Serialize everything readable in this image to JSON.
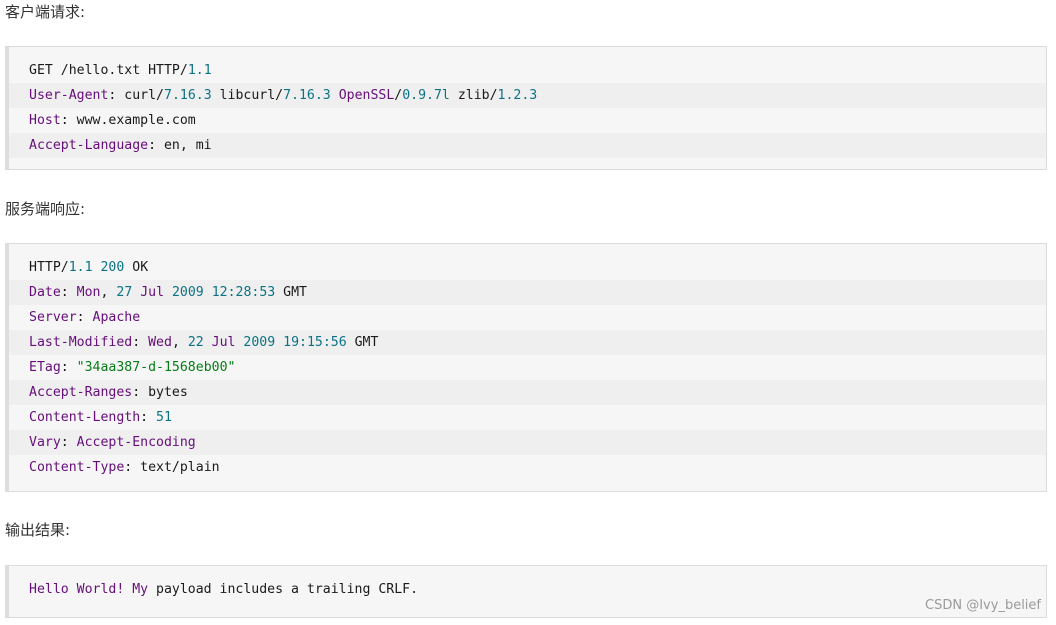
{
  "sections": [
    {
      "label": "客户端请求:",
      "lines": [
        [
          [
            "GET ",
            "plain"
          ],
          [
            "/hello.txt HTTP/",
            "plain"
          ],
          [
            "1.1",
            "num"
          ]
        ],
        [
          [
            "User-Agent",
            "key"
          ],
          [
            ": ",
            "punc"
          ],
          [
            "curl/",
            "plain"
          ],
          [
            "7.16.3",
            "num"
          ],
          [
            " libcurl/",
            "plain"
          ],
          [
            "7.16.3",
            "num"
          ],
          [
            " OpenSSL",
            "key"
          ],
          [
            "/",
            "plain"
          ],
          [
            "0.9.7l",
            "num"
          ],
          [
            " zlib/",
            "plain"
          ],
          [
            "1.2.3",
            "num"
          ]
        ],
        [
          [
            "Host",
            "key"
          ],
          [
            ": ",
            "punc"
          ],
          [
            "www.example.com",
            "plain"
          ]
        ],
        [
          [
            "Accept-Language",
            "key"
          ],
          [
            ": ",
            "punc"
          ],
          [
            "en, mi",
            "plain"
          ]
        ]
      ]
    },
    {
      "label": "服务端响应:",
      "lines": [
        [
          [
            "HTTP/",
            "plain"
          ],
          [
            "1.1",
            "num"
          ],
          [
            " ",
            "plain"
          ],
          [
            "200",
            "num"
          ],
          [
            " OK",
            "plain"
          ]
        ],
        [
          [
            "Date",
            "key"
          ],
          [
            ": ",
            "punc"
          ],
          [
            "Mon",
            "key"
          ],
          [
            ", ",
            "punc"
          ],
          [
            "27",
            "num"
          ],
          [
            " Jul ",
            "key"
          ],
          [
            "2009",
            "num"
          ],
          [
            " ",
            "plain"
          ],
          [
            "12:28:53",
            "num"
          ],
          [
            " GMT",
            "plain"
          ]
        ],
        [
          [
            "Server",
            "key"
          ],
          [
            ": ",
            "punc"
          ],
          [
            "Apache",
            "key"
          ]
        ],
        [
          [
            "Last-Modified",
            "key"
          ],
          [
            ": ",
            "punc"
          ],
          [
            "Wed",
            "key"
          ],
          [
            ", ",
            "punc"
          ],
          [
            "22",
            "num"
          ],
          [
            " Jul ",
            "key"
          ],
          [
            "2009",
            "num"
          ],
          [
            " ",
            "plain"
          ],
          [
            "19:15:56",
            "num"
          ],
          [
            " GMT",
            "plain"
          ]
        ],
        [
          [
            "ETag",
            "key"
          ],
          [
            ": ",
            "punc"
          ],
          [
            "\"34aa387-d-1568eb00\"",
            "str"
          ]
        ],
        [
          [
            "Accept-Ranges",
            "key"
          ],
          [
            ": ",
            "punc"
          ],
          [
            "bytes",
            "plain"
          ]
        ],
        [
          [
            "Content-Length",
            "key"
          ],
          [
            ": ",
            "punc"
          ],
          [
            "51",
            "num"
          ]
        ],
        [
          [
            "Vary",
            "key"
          ],
          [
            ": ",
            "punc"
          ],
          [
            "Accept-Encoding",
            "key"
          ]
        ],
        [
          [
            "Content-Type",
            "key"
          ],
          [
            ": ",
            "punc"
          ],
          [
            "text/plain",
            "plain"
          ]
        ]
      ]
    },
    {
      "label": "输出结果:",
      "lines": [
        [
          [
            "Hello World! My",
            "key"
          ],
          [
            " payload includes a trailing CRLF.",
            "plain"
          ]
        ]
      ]
    }
  ],
  "watermark": "CSDN @Ivy_belief",
  "colors": {
    "key": "#660e7a",
    "num": "#0b7285",
    "str": "#067d17",
    "plain": "#1a1a1a"
  }
}
